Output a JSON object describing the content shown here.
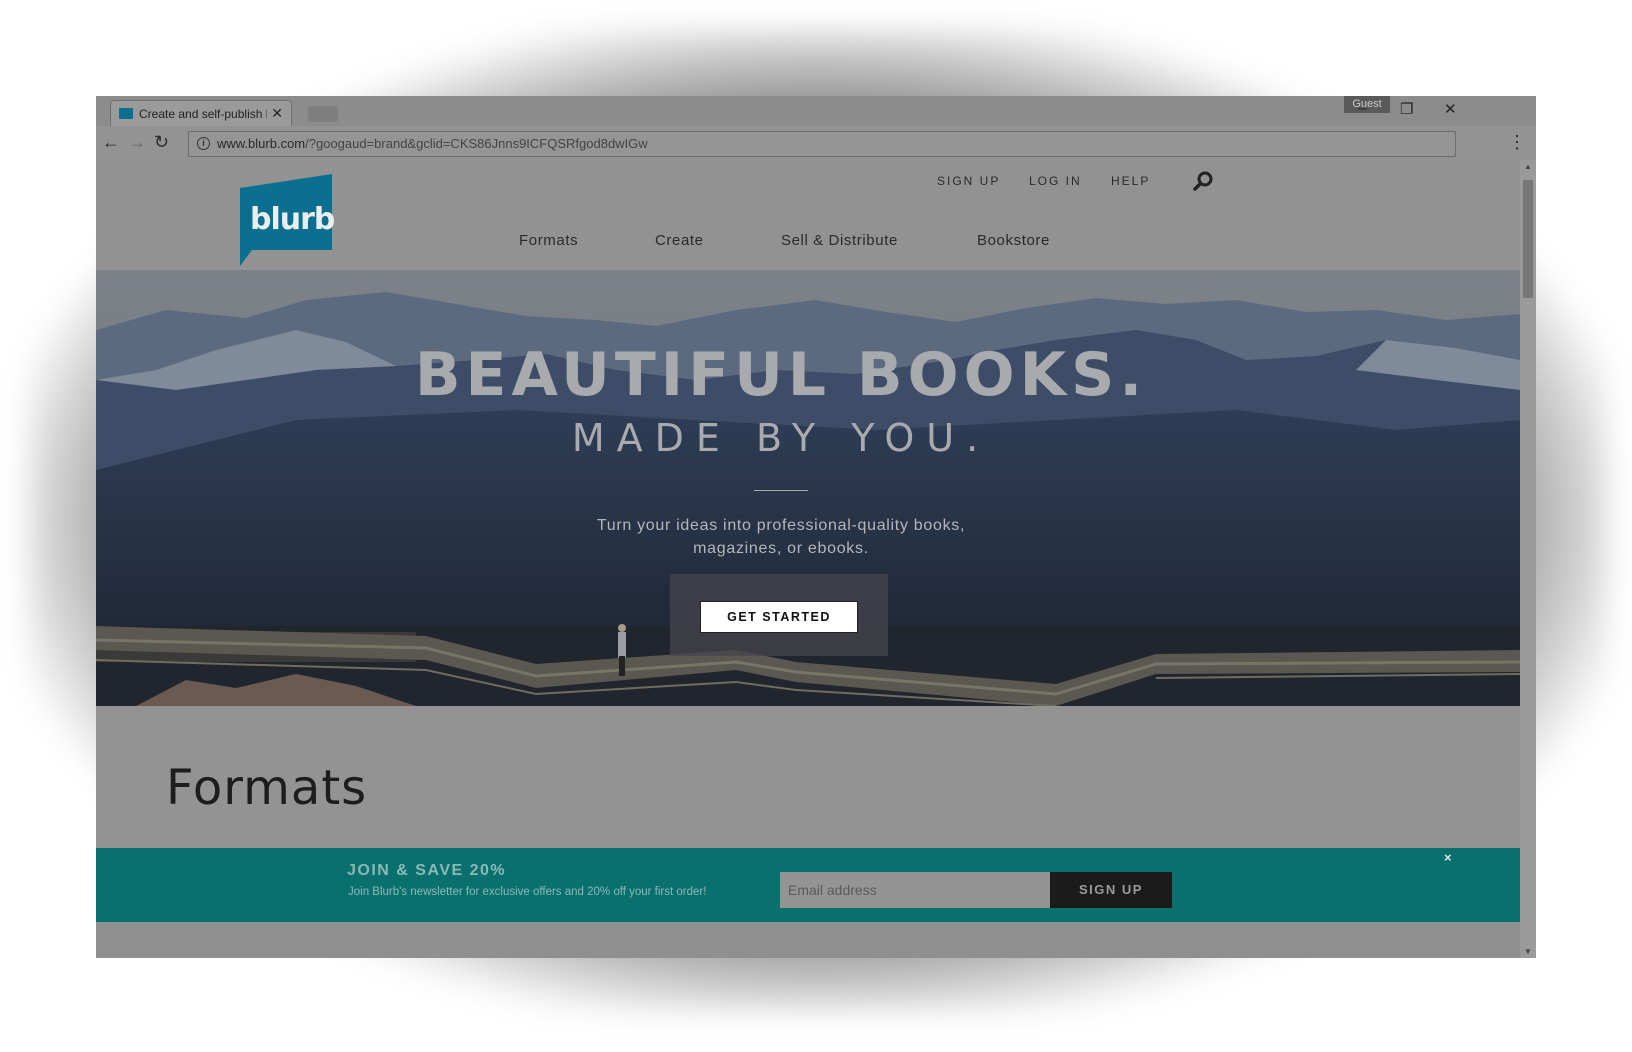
{
  "browser": {
    "tab_title": "Create and self-publish b",
    "guest_label": "Guest",
    "url_host": "www.blurb.com",
    "url_rest": "/?googaud=brand&gclid=CKS86Jnns9ICFQSRfgod8dwIGw"
  },
  "site": {
    "logo_text": "blurb",
    "util_nav": [
      "SIGN UP",
      "LOG IN",
      "HELP"
    ],
    "main_nav": [
      "Formats",
      "Create",
      "Sell & Distribute",
      "Bookstore"
    ],
    "brand_color": "#0c7fa8"
  },
  "hero": {
    "headline": "BEAUTIFUL BOOKS.",
    "subheadline": "MADE BY YOU.",
    "body_line1": "Turn your ideas into professional-quality books,",
    "body_line2": "magazines, or ebooks.",
    "cta": "GET STARTED"
  },
  "formats": {
    "title": "Formats"
  },
  "newsletter": {
    "title": "JOIN & SAVE 20%",
    "subtitle": "Join Blurb's newsletter for exclusive offers and 20% off your first order!",
    "email_placeholder": "Email address",
    "signup": "SIGN UP",
    "close": "×",
    "bar_color": "#09706e"
  },
  "icons": [
    "back-arrow-icon",
    "forward-arrow-icon",
    "reload-icon",
    "info-icon",
    "menu-dots-icon",
    "search-icon",
    "close-icon",
    "minimize-icon",
    "maximize-icon"
  ]
}
